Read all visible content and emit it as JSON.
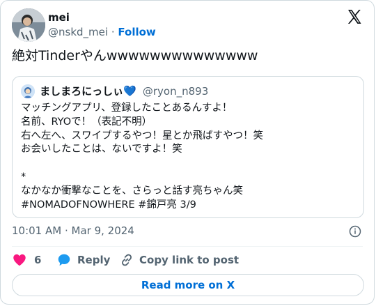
{
  "author": {
    "name": "mei",
    "handle": "@nskd_mei",
    "separator": "·",
    "follow_label": "Follow"
  },
  "tweet_text": "絶対Tinderやんwwwwwwwwwwwwww",
  "quoted": {
    "name": "ましまろにっしぃ",
    "heart_emoji": "💙",
    "handle": "@ryon_n893",
    "lines": [
      "マッチングアプリ、登録したことあるんすよ！",
      "名前、RYOで！（表記不明）",
      "右へ左へ、スワイプするやつ！星とか飛ばすやつ！笑",
      "お会いしたことは、ないですよ！笑",
      "",
      "*",
      "なかなか衝撃なことを、さらっと話す亮ちゃん笑",
      "#NOMADOFNOWHERE #錦戸亮 3/9"
    ]
  },
  "meta": {
    "timestamp": "10:01 AM · Mar 9, 2024"
  },
  "actions": {
    "likes_count": "6",
    "reply_label": "Reply",
    "copy_link_label": "Copy link to post"
  },
  "read_more_label": "Read more on X",
  "colors": {
    "link_blue": "#006fd6",
    "heart_pink": "#f91880",
    "reply_blue": "#1d9bf0",
    "muted_text": "#536471",
    "border": "#cfd9de"
  }
}
